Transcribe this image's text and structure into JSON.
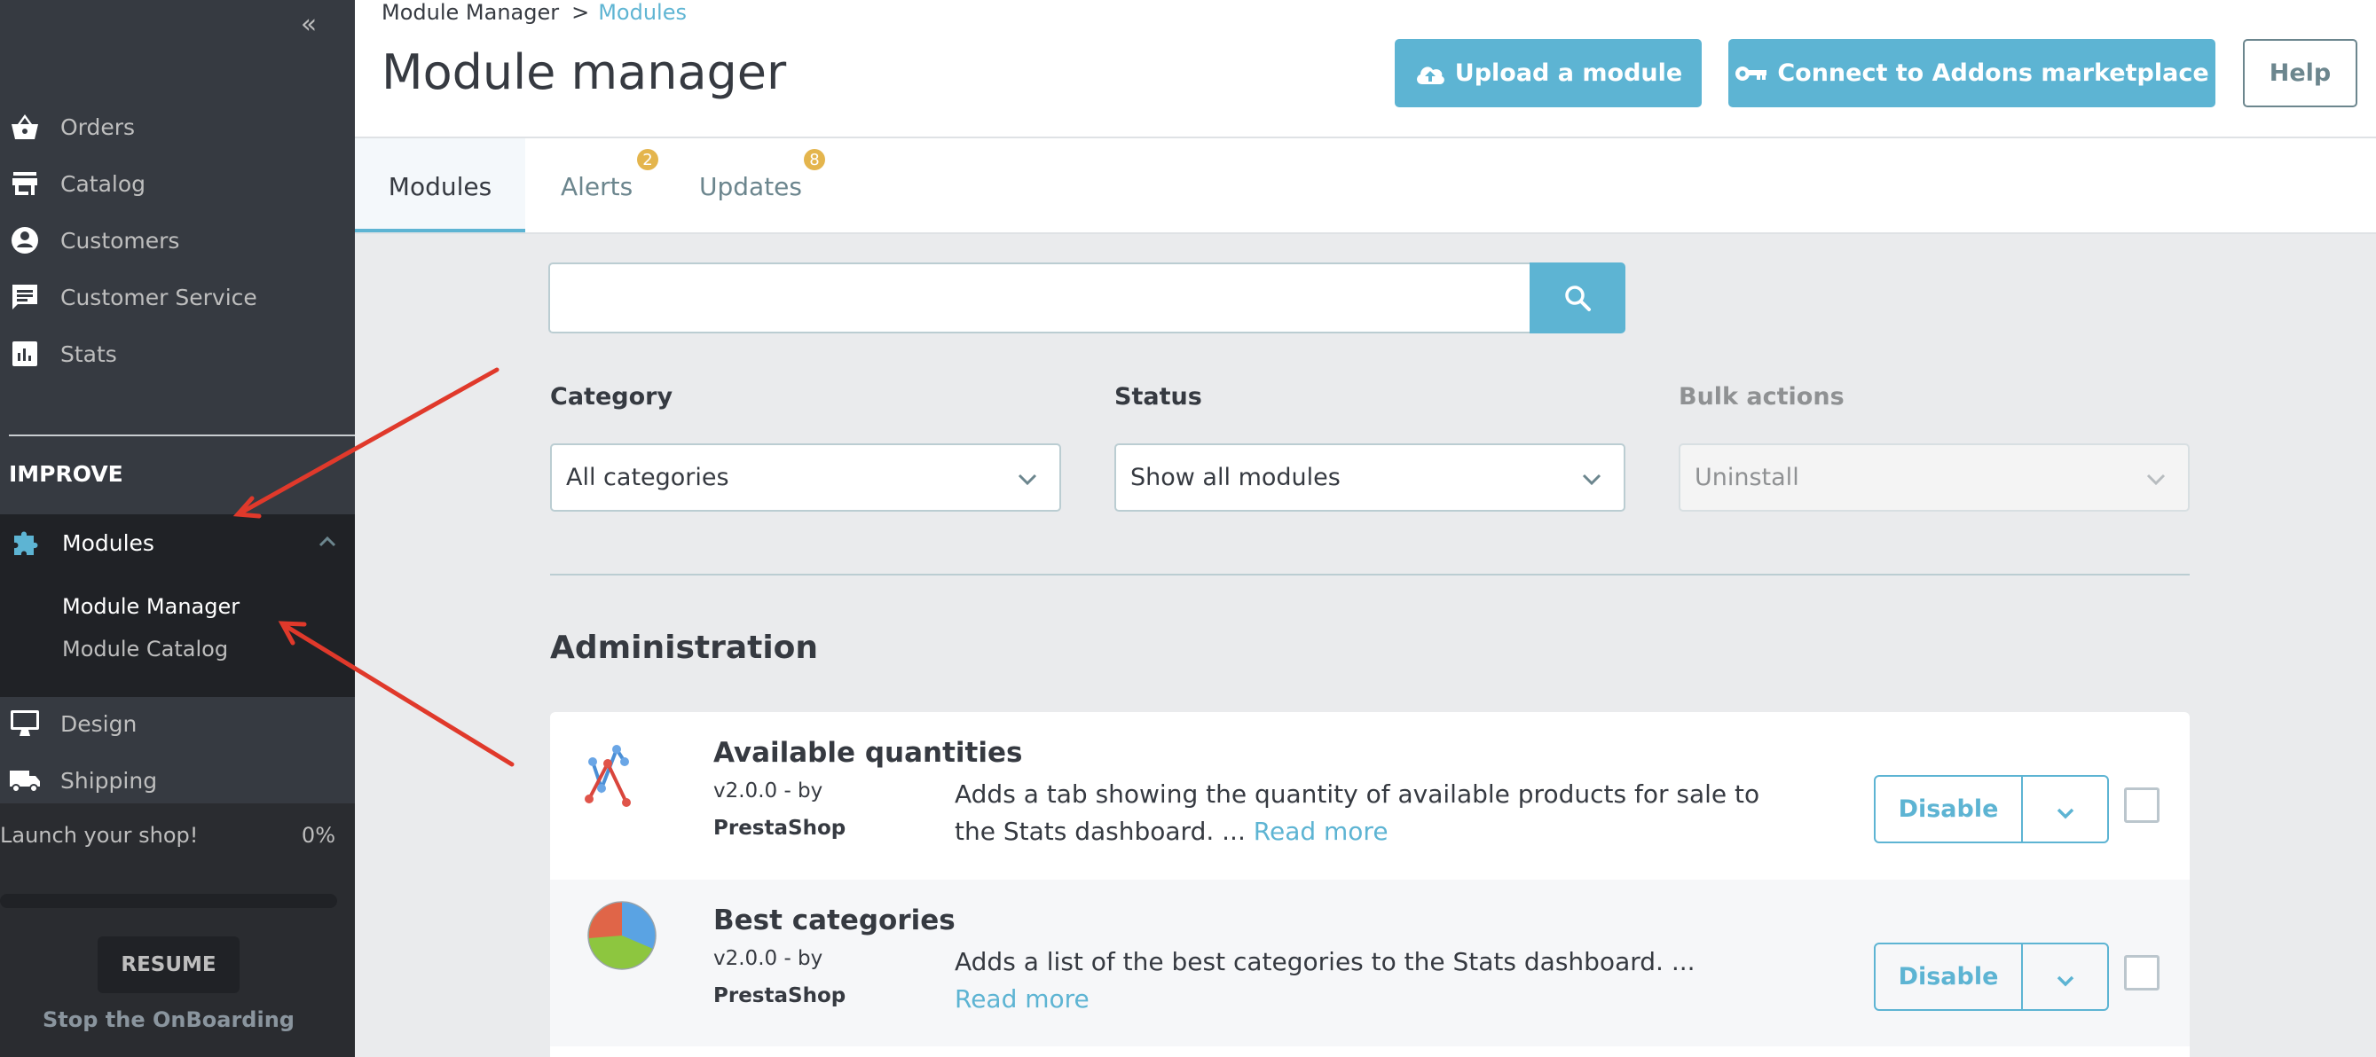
{
  "sidebar": {
    "collapse_label": "«",
    "items": [
      {
        "label": "Orders",
        "icon": "basket-icon"
      },
      {
        "label": "Catalog",
        "icon": "store-icon"
      },
      {
        "label": "Customers",
        "icon": "account-circle-icon"
      },
      {
        "label": "Customer Service",
        "icon": "chat-icon"
      },
      {
        "label": "Stats",
        "icon": "bar-chart-icon"
      }
    ],
    "section_title": "IMPROVE",
    "modules": {
      "label": "Modules",
      "icon": "puzzle-icon",
      "expanded": true,
      "children": [
        {
          "label": "Module Manager",
          "active": true
        },
        {
          "label": "Module Catalog",
          "active": false
        }
      ]
    },
    "items_after": [
      {
        "label": "Design",
        "icon": "monitor-icon"
      },
      {
        "label": "Shipping",
        "icon": "truck-icon"
      }
    ],
    "onboarding": {
      "label": "Launch your shop!",
      "percent_label": "0%",
      "progress": 0,
      "resume_label": "RESUME",
      "stop_label": "Stop the OnBoarding"
    }
  },
  "header": {
    "breadcrumb": {
      "parent": "Module Manager",
      "separator": ">",
      "current": "Modules"
    },
    "title": "Module manager",
    "buttons": {
      "upload": "Upload a module",
      "connect": "Connect to Addons marketplace",
      "help": "Help"
    },
    "tabs": [
      {
        "label": "Modules",
        "active": true
      },
      {
        "label": "Alerts",
        "badge": "2"
      },
      {
        "label": "Updates",
        "badge": "8"
      }
    ]
  },
  "search": {
    "value": "",
    "placeholder": ""
  },
  "filters": {
    "category": {
      "label": "Category",
      "value": "All categories"
    },
    "status": {
      "label": "Status",
      "value": "Show all modules"
    },
    "bulk": {
      "label": "Bulk actions",
      "value": "Uninstall",
      "disabled": true
    }
  },
  "section": {
    "title": "Administration",
    "modules": [
      {
        "name": "Available quantities",
        "version": "v2.0.0 - by",
        "author": "PrestaShop",
        "description": "Adds a tab showing the quantity of available products for sale to the Stats dashboard. ...",
        "read_more": "Read more",
        "action": "Disable",
        "icon": "line-chart-icon"
      },
      {
        "name": "Best categories",
        "version": "v2.0.0 - by",
        "author": "PrestaShop",
        "description": "Adds a list of the best categories to the Stats dashboard. ...",
        "read_more": "Read more",
        "action": "Disable",
        "icon": "pie-chart-icon"
      }
    ]
  },
  "colors": {
    "accent": "#5db4d3",
    "sidebar_bg": "#363a41",
    "badge": "#e4b54d",
    "annotation_arrow": "#e0392b"
  }
}
